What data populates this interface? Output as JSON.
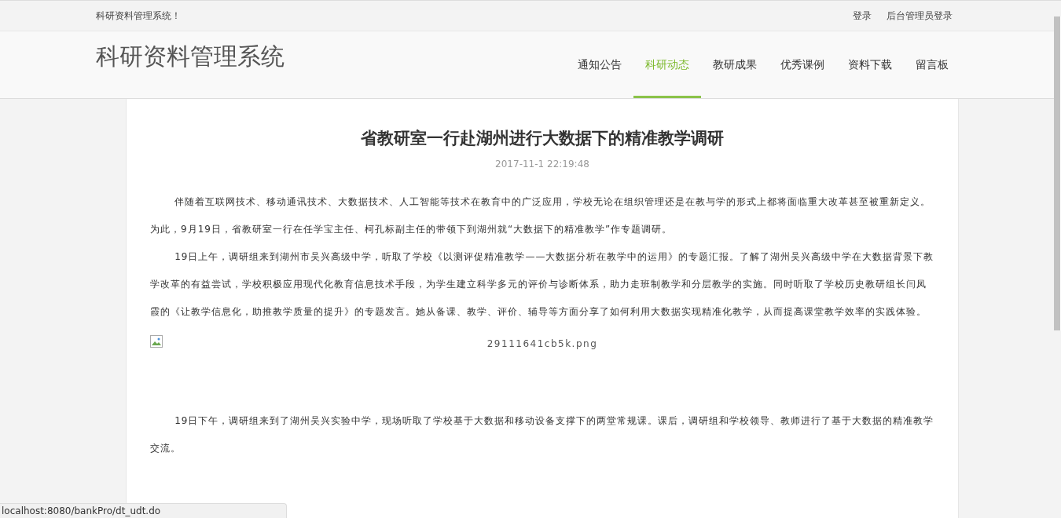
{
  "top_bar": {
    "welcome": "科研资料管理系统！",
    "links": [
      "登录",
      "后台管理员登录"
    ]
  },
  "header": {
    "logo": "科研资料管理系统",
    "nav": [
      {
        "label": "通知公告",
        "selected": false
      },
      {
        "label": "科研动态",
        "selected": true
      },
      {
        "label": "教研成果",
        "selected": false
      },
      {
        "label": "优秀课例",
        "selected": false
      },
      {
        "label": "资料下载",
        "selected": false
      },
      {
        "label": "留言板",
        "selected": false
      }
    ]
  },
  "article": {
    "title": "省教研室一行赴湖州进行大数据下的精准教学调研",
    "date": "2017-11-1 22:19:48",
    "blocks": [
      {
        "kind": "paragraph",
        "text": "伴随着互联网技术、移动通讯技术、大数据技术、人工智能等技术在教育中的广泛应用，学校无论在组织管理还是在教与学的形式上都将面临重大改革甚至被重新定义。为此，9月19日，省教研室一行在任学宝主任、柯孔标副主任的带领下到湖州就“大数据下的精准教学”作专题调研。"
      },
      {
        "kind": "paragraph",
        "text": "19日上午，调研组来到湖州市吴兴高级中学，听取了学校《以测评促精准教学——大数据分析在教学中的运用》的专题汇报。了解了湖州吴兴高级中学在大数据背景下教学改革的有益尝试，学校积极应用现代化教育信息技术手段，为学生建立科学多元的评价与诊断体系，助力走班制教学和分层教学的实施。同时听取了学校历史教研组长闫凤霞的《让教学信息化，助推教学质量的提升》的专题发言。她从备课、教学、评价、辅导等方面分享了如何利用大数据实现精准化教学，从而提高课堂教学效率的实践体验。"
      },
      {
        "kind": "image",
        "text": "29111641cb5k.png"
      },
      {
        "kind": "paragraph",
        "text": "19日下午，调研组来到了湖州吴兴实验中学，现场听取了学校基于大数据和移动设备支撑下的两堂常规课。课后，调研组和学校领导、教师进行了基于大数据的精准教学交流。"
      }
    ]
  },
  "status_bar": {
    "url": "localhost:8080/bankPro/dt_udt.do"
  }
}
